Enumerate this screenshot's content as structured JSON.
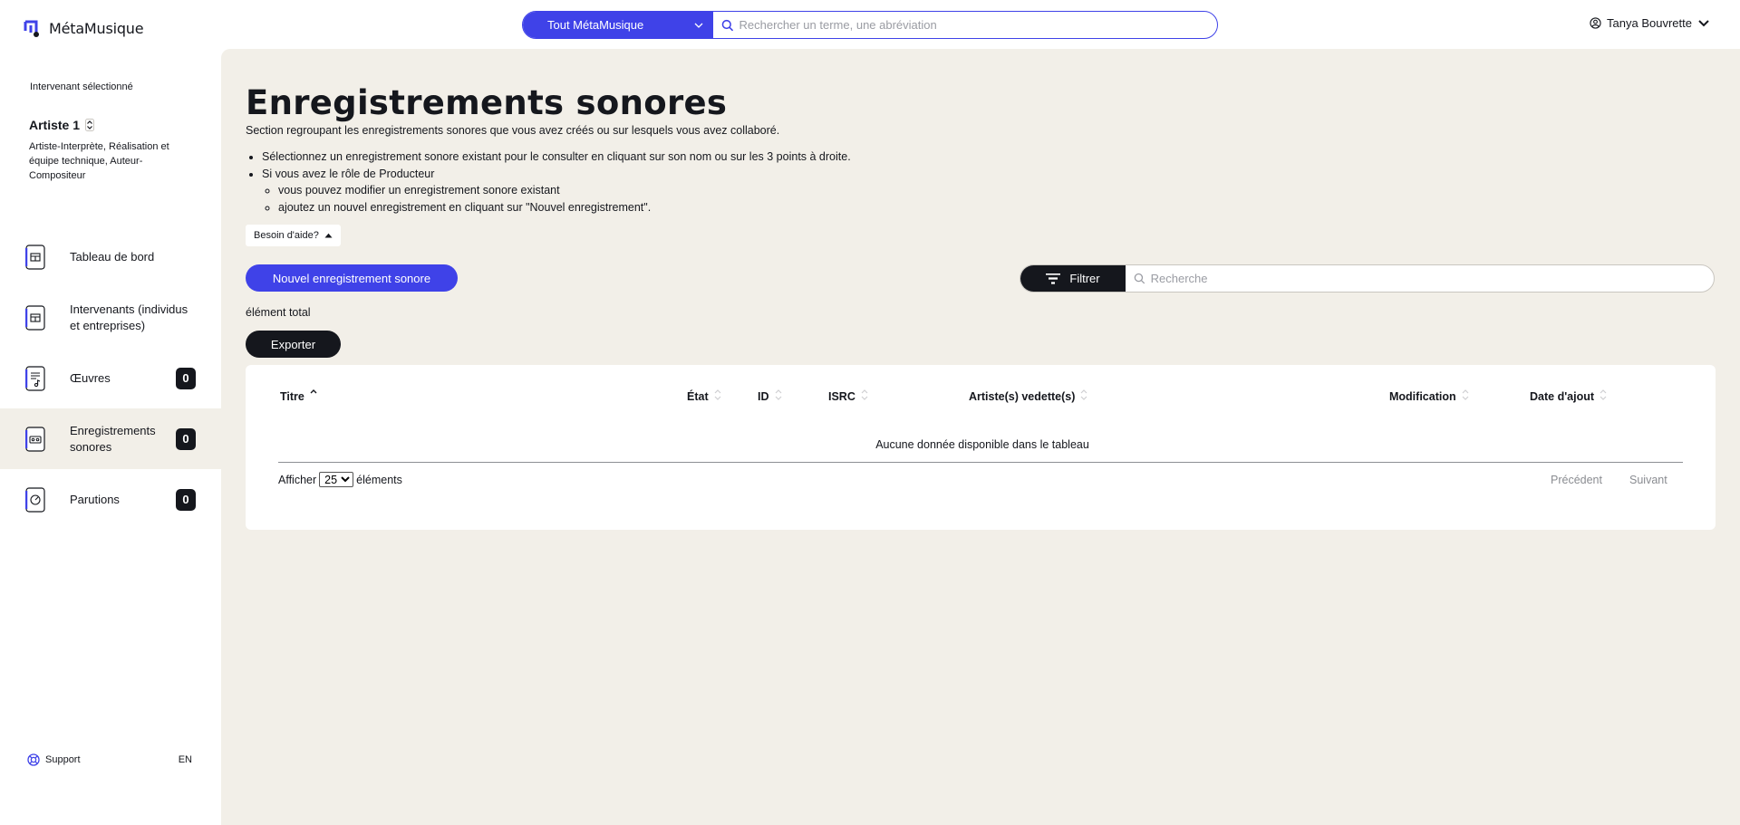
{
  "app": {
    "brand": "MétaMusique",
    "search": {
      "scope": "Tout MétaMusique",
      "placeholder": "Rechercher un terme, une abréviation"
    },
    "user": "Tanya Bouvrette"
  },
  "colors": {
    "accent": "#3f42e8",
    "dark": "#15171d",
    "background": "#f2efe8",
    "nav_icon_blue": "#3f42e8"
  },
  "sidebar": {
    "selected_label": "Intervenant sélectionné",
    "artist_name": "Artiste 1",
    "artist_roles": "Artiste-Interprète, Réalisation et équipe technique, Auteur-Compositeur",
    "items": [
      {
        "label": "Tableau de bord",
        "icon": "dashboard-icon",
        "badge": "",
        "active": false
      },
      {
        "label": "Intervenants (individus et entreprises)",
        "icon": "people-icon",
        "badge": "",
        "active": false
      },
      {
        "label": "Œuvres",
        "icon": "musical-work-icon",
        "badge": "0",
        "active": false
      },
      {
        "label": "Enregistrements sonores",
        "icon": "sound-recording-icon",
        "badge": "0",
        "active": true
      },
      {
        "label": "Parutions",
        "icon": "release-disc-icon",
        "badge": "0",
        "active": false
      }
    ],
    "support": "Support",
    "language": "EN"
  },
  "main": {
    "title": "Enregistrements sonores",
    "description": "Section regroupant les enregistrements sonores que vous avez créés ou sur lesquels vous avez collaboré.",
    "instructions": {
      "line1": "Sélectionnez un enregistrement sonore existant pour le consulter en cliquant sur son nom ou sur les 3 points à droite.",
      "line2": "Si vous avez le rôle de Producteur",
      "sub1": "vous pouvez modifier un enregistrement sonore existant",
      "sub2": "ajoutez un nouvel enregistrement en cliquant sur \"Nouvel enregistrement\"."
    },
    "help_button": "Besoin d'aide?",
    "new_button": "Nouvel enregistrement sonore",
    "filter_button": "Filtrer",
    "filter_placeholder": "Recherche",
    "total_text": "élément total",
    "export_button": "Exporter"
  },
  "table": {
    "columns": [
      "Titre",
      "État",
      "ID",
      "ISRC",
      "Artiste(s) vedette(s)",
      "Modification",
      "Date d'ajout"
    ],
    "sorted_column": "Titre",
    "empty_message": "Aucune donnée disponible dans le tableau",
    "length_prefix": "Afficher",
    "length_value": "25",
    "length_suffix": "éléments",
    "prev": "Précédent",
    "next": "Suivant"
  }
}
